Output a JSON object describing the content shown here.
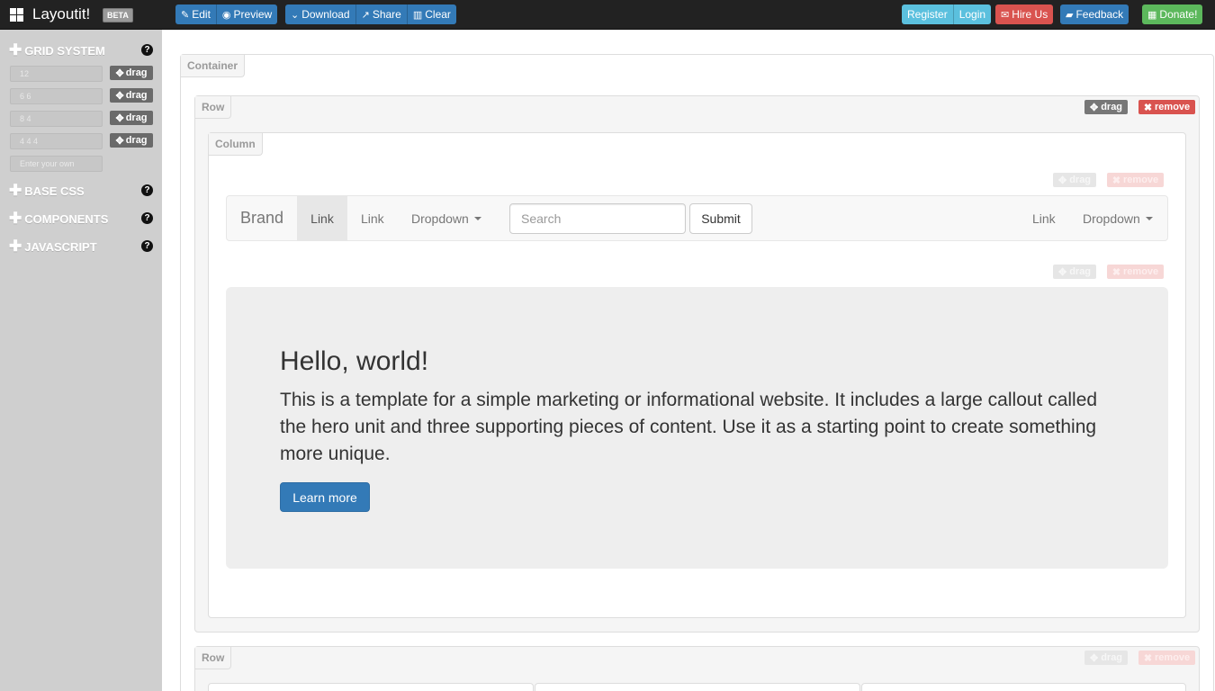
{
  "topbar": {
    "brand": "Layoutit!",
    "beta": "BETA",
    "edit_group": [
      {
        "label": "Edit",
        "icon": "edit-icon",
        "glyph": "✎"
      },
      {
        "label": "Preview",
        "icon": "eye-icon",
        "glyph": "◉"
      }
    ],
    "file_group": [
      {
        "label": "Download",
        "icon": "chevron-down-icon",
        "glyph": "⌄"
      },
      {
        "label": "Share",
        "icon": "share-icon",
        "glyph": "↗"
      },
      {
        "label": "Clear",
        "icon": "trash-icon",
        "glyph": "🗑"
      }
    ],
    "register": "Register",
    "login": "Login",
    "hire_us": "Hire Us",
    "feedback": "Feedback",
    "donate": "Donate!"
  },
  "sidebar": {
    "grid_system": "GRID SYSTEM",
    "grid_rows": [
      {
        "value": "12",
        "drag": "drag"
      },
      {
        "value": "6 6",
        "drag": "drag"
      },
      {
        "value": "8 4",
        "drag": "drag"
      },
      {
        "value": "4 4 4",
        "drag": "drag"
      }
    ],
    "enter_own": "Enter your own",
    "base_css": "BASE CSS",
    "components": "COMPONENTS",
    "javascript": "JAVASCRIPT",
    "help": "?"
  },
  "canvas": {
    "container_tag": "Container",
    "row_tag": "Row",
    "column_tag": "Column",
    "drag": "drag",
    "remove": "remove"
  },
  "inner_navbar": {
    "brand": "Brand",
    "link_active": "Link",
    "link": "Link",
    "dropdown": "Dropdown",
    "search_placeholder": "Search",
    "submit": "Submit",
    "right_link": "Link",
    "right_dropdown": "Dropdown"
  },
  "hero": {
    "title": "Hello, world!",
    "text": "This is a template for a simple marketing or informational website. It includes a large callout called the hero unit and three supporting pieces of content. Use it as a starting point to create something more unique.",
    "button": "Learn more"
  },
  "colors": {
    "topbar": "#222222",
    "sidebar": "#cfcfcf",
    "primary": "#337ab7",
    "info": "#5bc0de",
    "danger": "#d9534f",
    "success": "#5cb85c"
  }
}
